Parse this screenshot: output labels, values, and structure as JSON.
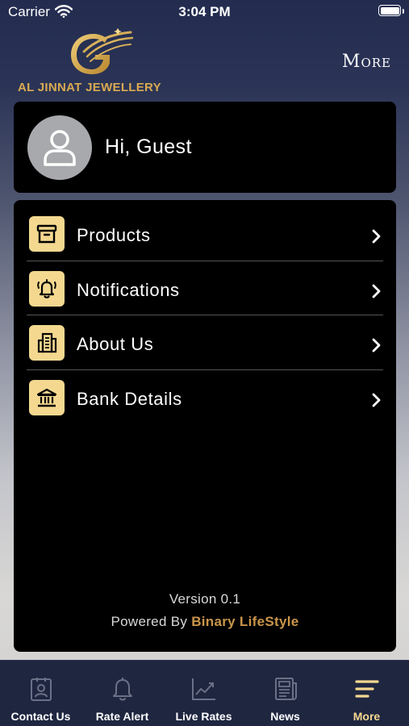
{
  "status_bar": {
    "carrier": "Carrier",
    "time": "3:04 PM"
  },
  "header": {
    "logo_text": "AL JINNAT JEWELLERY",
    "title": "More"
  },
  "profile": {
    "greeting": "Hi, Guest"
  },
  "menu": {
    "items": [
      {
        "label": "Products",
        "icon": "archive-box-icon"
      },
      {
        "label": "Notifications",
        "icon": "bell-ringing-icon"
      },
      {
        "label": "About Us",
        "icon": "building-icon"
      },
      {
        "label": "Bank Details",
        "icon": "bank-icon"
      }
    ]
  },
  "footer": {
    "version": "Version 0.1",
    "powered_by": "Powered By",
    "brand": "Binary LifeStyle"
  },
  "tabs": [
    {
      "label": "Contact Us",
      "icon": "contact-card-icon",
      "active": false
    },
    {
      "label": "Rate Alert",
      "icon": "bell-icon",
      "active": false
    },
    {
      "label": "Live Rates",
      "icon": "trend-chart-icon",
      "active": false
    },
    {
      "label": "News",
      "icon": "newspaper-icon",
      "active": false
    },
    {
      "label": "More",
      "icon": "menu-lines-icon",
      "active": true
    }
  ],
  "colors": {
    "accent_gold": "#f4d890",
    "brand_gold": "#d9aa52",
    "card_bg": "#000000",
    "tab_bar_bg": "#1f2640"
  }
}
